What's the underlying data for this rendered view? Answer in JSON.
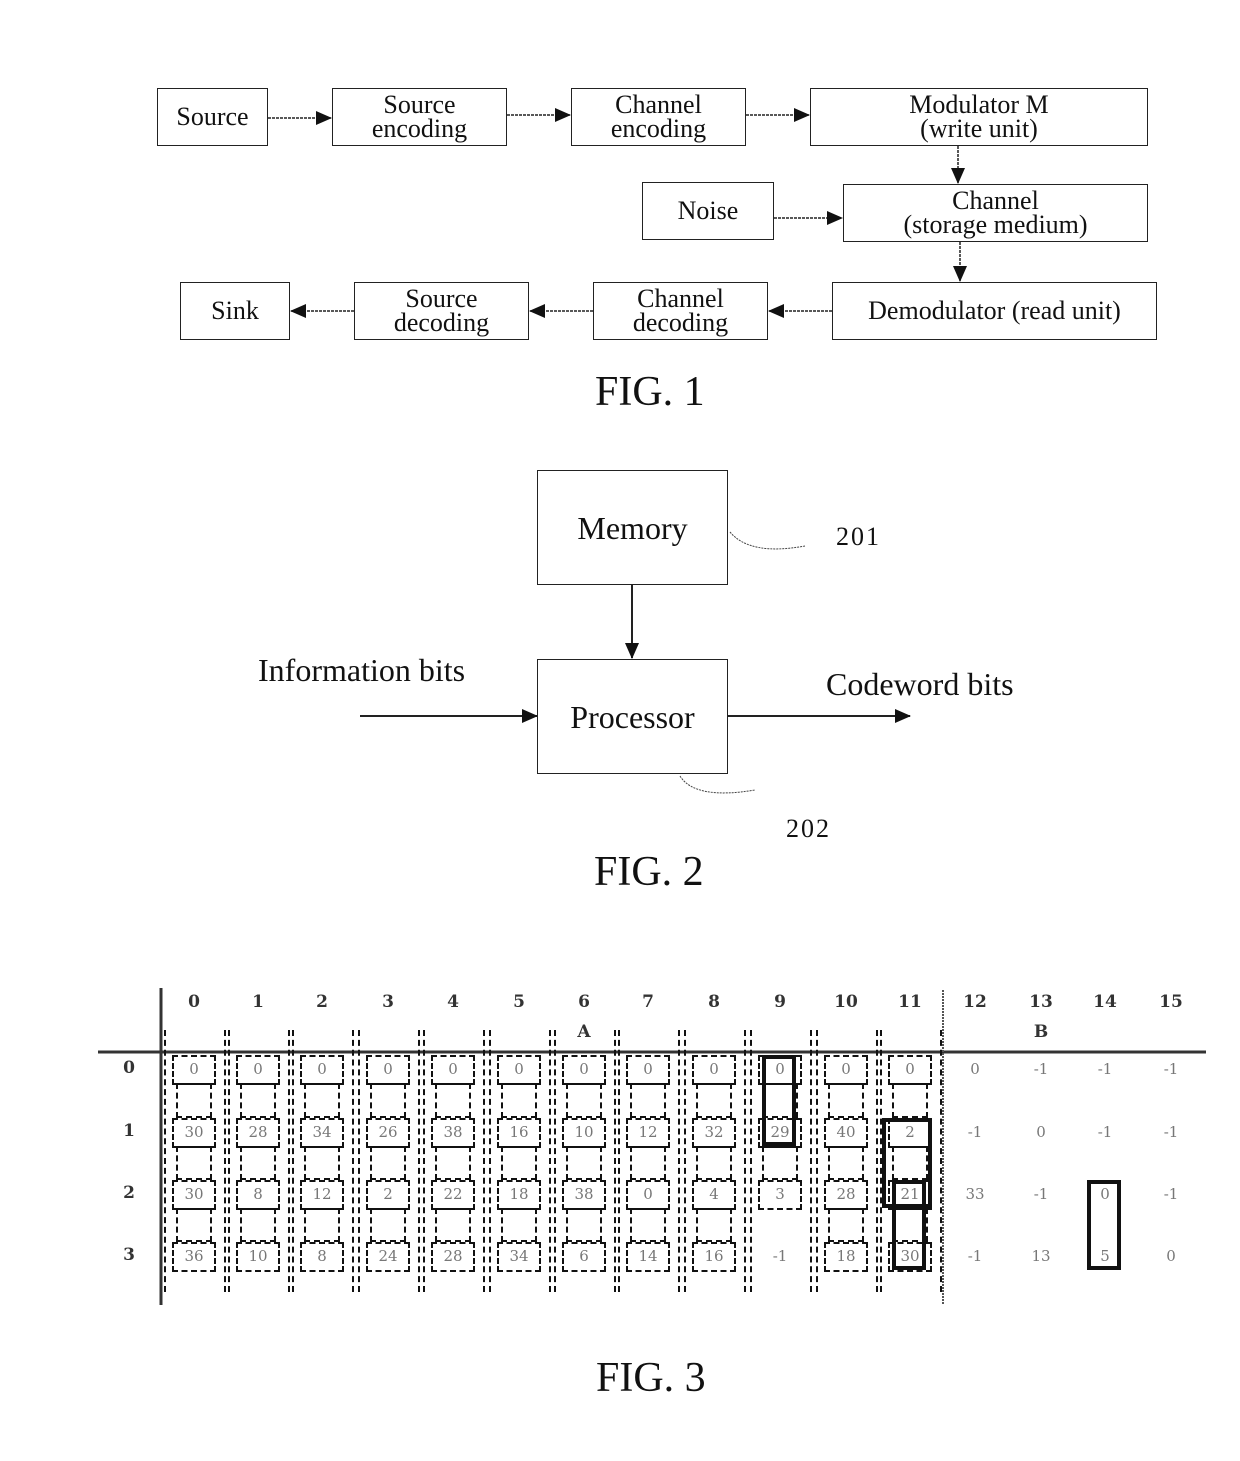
{
  "fig1": {
    "caption": "FIG. 1",
    "blocks": {
      "source": [
        "Source"
      ],
      "source_encoding": [
        "Source",
        "encoding"
      ],
      "channel_encoding": [
        "Channel",
        "encoding"
      ],
      "modulator": [
        "Modulator M",
        "(write unit)"
      ],
      "noise": [
        "Noise"
      ],
      "channel": [
        "Channel",
        "(storage medium)"
      ],
      "demodulator": [
        "Demodulator (read unit)"
      ],
      "channel_decoding": [
        "Channel",
        "decoding"
      ],
      "source_decoding": [
        "Source",
        "decoding"
      ],
      "sink": [
        "Sink"
      ]
    }
  },
  "fig2": {
    "caption": "FIG. 2",
    "memory": "Memory",
    "processor": "Processor",
    "input_label": "Information bits",
    "output_label": "Codeword bits",
    "ref_memory": "201",
    "ref_processor": "202"
  },
  "fig3": {
    "caption": "FIG. 3",
    "column_headers": [
      "0",
      "1",
      "2",
      "3",
      "4",
      "5",
      "6",
      "7",
      "8",
      "9",
      "10",
      "11",
      "12",
      "13",
      "14",
      "15"
    ],
    "row_headers": [
      "0",
      "1",
      "2",
      "3"
    ],
    "region_labels": {
      "A": "A",
      "B": "B"
    },
    "region_label_columns": {
      "A": 6,
      "B": 13
    },
    "matrix": [
      [
        "0",
        "0",
        "0",
        "0",
        "0",
        "0",
        "0",
        "0",
        "0",
        "0",
        "0",
        "0",
        "0",
        "-1",
        "-1",
        "-1"
      ],
      [
        "30",
        "28",
        "34",
        "26",
        "38",
        "16",
        "10",
        "12",
        "32",
        "29",
        "40",
        "2",
        "-1",
        "0",
        "-1",
        "-1"
      ],
      [
        "30",
        "8",
        "12",
        "2",
        "22",
        "18",
        "38",
        "0",
        "4",
        "3",
        "28",
        "21",
        "33",
        "-1",
        "0",
        "-1"
      ],
      [
        "36",
        "10",
        "8",
        "24",
        "28",
        "34",
        "6",
        "14",
        "16",
        "-1",
        "18",
        "30",
        "-1",
        "13",
        "5",
        "0"
      ]
    ],
    "highlighted_groups": [
      {
        "column": 9,
        "rows": [
          0,
          1
        ]
      },
      {
        "column": 11,
        "rows": [
          1,
          2
        ]
      },
      {
        "column": 11,
        "rows": [
          2,
          3
        ]
      },
      {
        "column": 14,
        "rows": [
          2,
          3
        ]
      }
    ]
  }
}
